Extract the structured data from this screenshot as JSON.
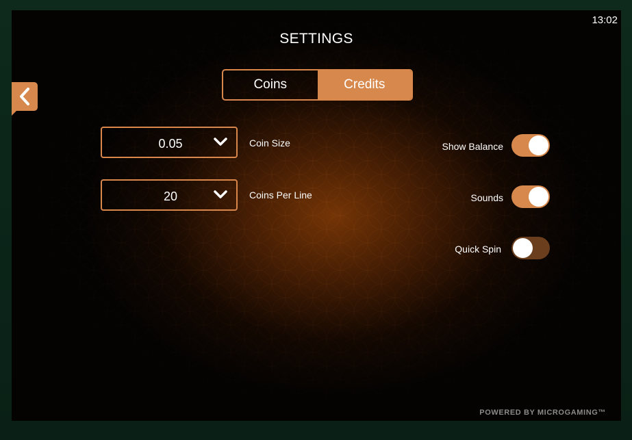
{
  "clock": "13:02",
  "title": "SETTINGS",
  "tabs": [
    {
      "label": "Coins",
      "active": false
    },
    {
      "label": "Credits",
      "active": true
    }
  ],
  "selects": [
    {
      "value": "0.05",
      "label": "Coin Size"
    },
    {
      "value": "20",
      "label": "Coins Per Line"
    }
  ],
  "toggles": [
    {
      "label": "Show Balance",
      "on": true
    },
    {
      "label": "Sounds",
      "on": true
    },
    {
      "label": "Quick Spin",
      "on": false
    }
  ],
  "footer": "POWERED BY MICROGAMING™",
  "colors": {
    "accent": "#d7894d",
    "toggle_off": "#6b3f1e",
    "background": "#050302"
  },
  "icons": {
    "back": "chevron-left-icon",
    "dropdown": "chevron-down-icon"
  }
}
